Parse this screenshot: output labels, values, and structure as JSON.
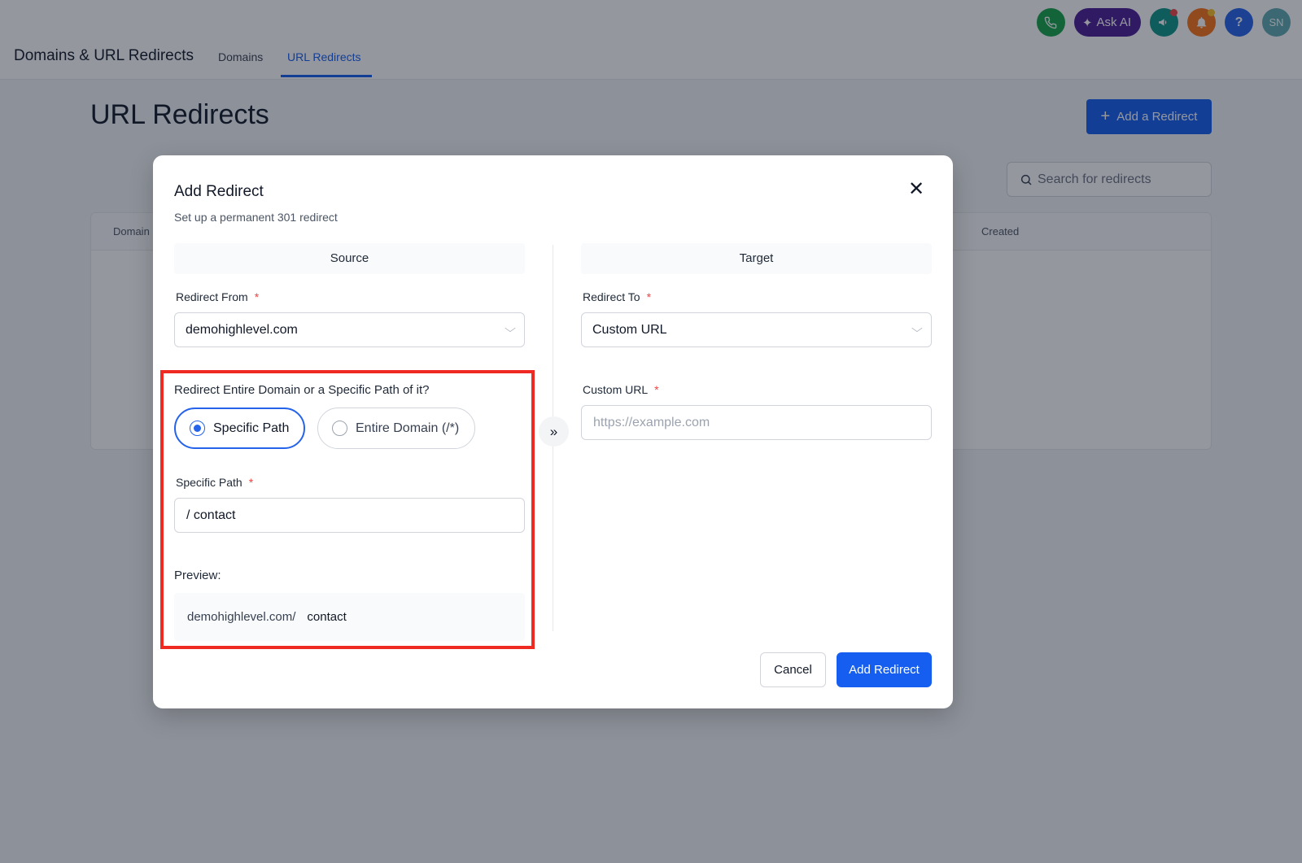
{
  "header": {
    "app_title": "Domains & URL Redirects",
    "tabs": [
      {
        "label": "Domains",
        "active": false
      },
      {
        "label": "URL Redirects",
        "active": true
      }
    ],
    "ask_ai_label": "Ask AI",
    "help_label": "?",
    "avatar_initials": "SN"
  },
  "page": {
    "title": "URL Redirects",
    "add_button_label": "Add a Redirect",
    "search_placeholder": "Search for redirects",
    "table_headers": [
      "Domain",
      "Created"
    ]
  },
  "modal": {
    "title": "Add Redirect",
    "subtitle": "Set up a permanent 301 redirect",
    "source_heading": "Source",
    "target_heading": "Target",
    "redirect_from_label": "Redirect From",
    "redirect_from_value": "demohighlevel.com",
    "redirect_to_label": "Redirect To",
    "redirect_to_value": "Custom URL",
    "question": "Redirect Entire Domain or a Specific Path of it?",
    "option_specific": "Specific Path",
    "option_entire": "Entire Domain (/*)",
    "selected_option": "Specific Path",
    "specific_path_label": "Specific Path",
    "specific_path_value": "/ contact",
    "preview_label": "Preview:",
    "preview_domain": "demohighlevel.com/",
    "preview_path": "contact",
    "custom_url_label": "Custom URL",
    "custom_url_placeholder": "https://example.com",
    "required_mark": "*",
    "cancel_label": "Cancel",
    "submit_label": "Add Redirect"
  },
  "colors": {
    "primary": "#155eef",
    "highlight": "#ef2a22",
    "required": "#ef4444"
  }
}
